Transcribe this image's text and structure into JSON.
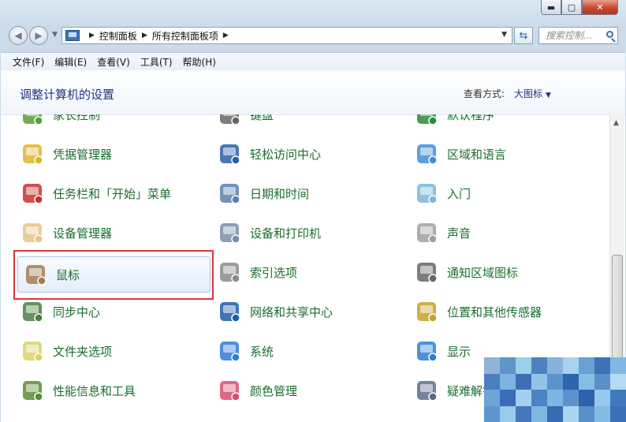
{
  "window": {
    "caption_buttons": {
      "minimize": "▬",
      "maximize": "▢",
      "close": "✕"
    }
  },
  "navbar": {
    "breadcrumb": [
      "控制面板",
      "所有控制面板项"
    ],
    "search_placeholder": "搜索控制..."
  },
  "menubar": {
    "items": [
      "文件(F)",
      "编辑(E)",
      "查看(V)",
      "工具(T)",
      "帮助(H)"
    ]
  },
  "header": {
    "title": "调整计算机的设置",
    "view_by_label": "查看方式:",
    "view_by_value": "大图标"
  },
  "grid": {
    "columns": [
      [
        "家长控制",
        "凭据管理器",
        "任务栏和「开始」菜单",
        "设备管理器",
        "鼠标",
        "同步中心",
        "文件夹选项",
        "性能信息和工具"
      ],
      [
        "键盘",
        "轻松访问中心",
        "日期和时间",
        "设备和打印机",
        "索引选项",
        "网络和共享中心",
        "系统",
        "颜色管理"
      ],
      [
        "默认程序",
        "区域和语言",
        "入门",
        "声音",
        "通知区域图标",
        "位置和其他传感器",
        "显示",
        "疑难解答"
      ]
    ],
    "selected": "鼠标"
  },
  "colors": {
    "link_green": "#1a6e2c",
    "title_blue": "#1e3287",
    "highlight_red": "#d9363d",
    "mosaic": [
      "#8fb4d8",
      "#5f95c8",
      "#9ad0e8",
      "#4c83bf",
      "#86b2dc",
      "#a8d2ef",
      "#6aa1d3",
      "#3c73b8",
      "#7fb8e2",
      "#4a80c0",
      "#7eb4e0",
      "#3e6fb6",
      "#92c4e8",
      "#5d94cc",
      "#2f65ae",
      "#84bde6",
      "#5a8fca",
      "#b3dcf4",
      "#6ea5d6",
      "#3a6db5",
      "#a4d0ef",
      "#4b84c4",
      "#7cb6e2",
      "#5b93cc",
      "#2e63ab",
      "#96c9ec",
      "#4178bc",
      "#5c96ce",
      "#98cbeb",
      "#4477bc",
      "#7db7e3",
      "#366ab2",
      "#a9d5f1",
      "#5890ca",
      "#83bbe4",
      "#3b70b7"
    ]
  }
}
